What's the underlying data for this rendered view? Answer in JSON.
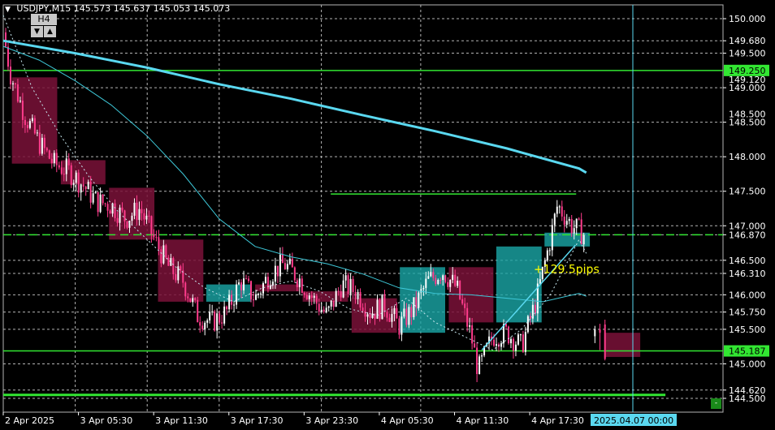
{
  "header": {
    "symbol": "USDJPY,M15",
    "open": "145.573",
    "high": "145.637",
    "low": "145.053",
    "close": "145.073"
  },
  "timeframe": {
    "label": "H4",
    "down_icon": "triangle-down-icon",
    "up_icon": "triangle-up-icon"
  },
  "colors": {
    "background": "#000000",
    "bull": "#ffffff",
    "bear": "#ff3c8c",
    "box_bear": "#7a1238",
    "box_bull": "#1aa7a7",
    "ma_slow": "#5ad8f0",
    "ma_fast": "#3ec8d8",
    "level": "#32e632",
    "grid": "#b4b4b4",
    "annotation": "#ffff00"
  },
  "chart_data": {
    "type": "candlestick",
    "symbol": "USDJPY",
    "timeframe": "M15",
    "ylim": [
      144.3,
      150.2
    ],
    "x_ticks": [
      "2 Apr 2025",
      "3 Apr 05:30",
      "3 Apr 11:30",
      "3 Apr 17:30",
      "3 Apr 23:30",
      "4 Apr 05:30",
      "4 Apr 11:30",
      "4 Apr 17:30"
    ],
    "y_ticks": [
      "150.000",
      "149.680",
      "149.500",
      "149.000",
      "148.500",
      "148.000",
      "147.500",
      "147.000",
      "146.870",
      "146.500",
      "146.310",
      "146.000",
      "145.750",
      "145.500",
      "145.000",
      "144.620",
      "144.500"
    ],
    "partial_labels": [
      "149.120",
      "148.500"
    ],
    "current_time_label": "2025.04.07 00:00",
    "price_tags": [
      {
        "label": "149.250",
        "value": 149.25
      },
      {
        "label": "145.187",
        "value": 145.187
      }
    ],
    "levels": [
      {
        "value": 149.25,
        "style": "solid",
        "x_from": 0,
        "x_to": 1
      },
      {
        "value": 147.46,
        "style": "solid",
        "x_from": 0.455,
        "x_to": 0.796
      },
      {
        "value": 146.87,
        "style": "dashed",
        "x_from": 0,
        "x_to": 1
      },
      {
        "value": 145.187,
        "style": "solid",
        "x_from": 0,
        "x_to": 1
      },
      {
        "value": 144.55,
        "style": "solid-thick",
        "x_from": 0,
        "x_to": 0.92
      }
    ],
    "annotation": {
      "text": "+129.5pips",
      "value": 146.36,
      "x": 0.816
    },
    "series": [
      {
        "kind": "ma-slow",
        "x": [
          0.0,
          0.1,
          0.2,
          0.3,
          0.4,
          0.5,
          0.6,
          0.7,
          0.8,
          0.81
        ],
        "values": [
          149.68,
          149.5,
          149.29,
          149.05,
          148.84,
          148.6,
          148.37,
          148.12,
          147.83,
          147.77
        ]
      },
      {
        "kind": "ma-fast",
        "x": [
          0.0,
          0.05,
          0.1,
          0.15,
          0.2,
          0.25,
          0.3,
          0.35,
          0.4,
          0.45,
          0.5,
          0.55,
          0.6,
          0.65,
          0.7,
          0.75,
          0.8,
          0.81
        ],
        "values": [
          149.6,
          149.4,
          149.1,
          148.75,
          148.3,
          147.75,
          147.1,
          146.7,
          146.55,
          146.45,
          146.3,
          146.1,
          146.02,
          146.0,
          145.95,
          145.9,
          146.02,
          145.98
        ]
      },
      {
        "kind": "ma-dotted",
        "x": [
          0.0,
          0.04,
          0.08,
          0.12,
          0.16,
          0.2,
          0.24,
          0.28,
          0.32,
          0.36,
          0.4,
          0.44,
          0.48,
          0.52,
          0.56,
          0.6,
          0.64,
          0.68,
          0.72,
          0.76,
          0.8,
          0.81
        ],
        "values": [
          150.05,
          149.0,
          148.3,
          147.7,
          147.2,
          146.8,
          146.4,
          146.1,
          145.9,
          146.1,
          146.2,
          146.05,
          145.8,
          145.7,
          145.95,
          145.6,
          145.4,
          145.2,
          145.5,
          146.0,
          146.8,
          146.6
        ]
      }
    ],
    "boxes": [
      {
        "kind": "bear",
        "x0": 0.012,
        "x1": 0.075,
        "top": 149.15,
        "bottom": 147.9
      },
      {
        "kind": "bear",
        "x0": 0.08,
        "x1": 0.142,
        "top": 147.95,
        "bottom": 147.6
      },
      {
        "kind": "bear",
        "x0": 0.147,
        "x1": 0.21,
        "top": 147.55,
        "bottom": 146.8
      },
      {
        "kind": "bear",
        "x0": 0.215,
        "x1": 0.278,
        "top": 146.8,
        "bottom": 145.9
      },
      {
        "kind": "bull",
        "x0": 0.282,
        "x1": 0.345,
        "top": 146.15,
        "bottom": 145.9
      },
      {
        "kind": "bear",
        "x0": 0.35,
        "x1": 0.412,
        "top": 146.15,
        "bottom": 146.05
      },
      {
        "kind": "bear",
        "x0": 0.416,
        "x1": 0.479,
        "top": 146.05,
        "bottom": 145.9
      },
      {
        "kind": "bear",
        "x0": 0.484,
        "x1": 0.547,
        "top": 145.95,
        "bottom": 145.45
      },
      {
        "kind": "bull",
        "x0": 0.551,
        "x1": 0.614,
        "top": 146.4,
        "bottom": 145.45
      },
      {
        "kind": "bear",
        "x0": 0.619,
        "x1": 0.681,
        "top": 146.4,
        "bottom": 145.6
      },
      {
        "kind": "bull",
        "x0": 0.685,
        "x1": 0.748,
        "top": 146.7,
        "bottom": 145.6
      },
      {
        "kind": "bull",
        "x0": 0.752,
        "x1": 0.815,
        "top": 146.9,
        "bottom": 146.7
      },
      {
        "kind": "bear",
        "x0": 0.835,
        "x1": 0.885,
        "top": 145.45,
        "bottom": 145.1
      }
    ],
    "candle_path": [
      [
        0.0,
        149.8
      ],
      [
        0.01,
        149.2
      ],
      [
        0.03,
        148.6
      ],
      [
        0.05,
        148.2
      ],
      [
        0.07,
        147.9
      ],
      [
        0.09,
        147.8
      ],
      [
        0.11,
        147.6
      ],
      [
        0.13,
        147.35
      ],
      [
        0.15,
        147.3
      ],
      [
        0.17,
        147.1
      ],
      [
        0.19,
        147.25
      ],
      [
        0.21,
        146.8
      ],
      [
        0.23,
        146.4
      ],
      [
        0.25,
        146.2
      ],
      [
        0.27,
        145.7
      ],
      [
        0.29,
        145.6
      ],
      [
        0.31,
        145.75
      ],
      [
        0.33,
        146.2
      ],
      [
        0.35,
        145.95
      ],
      [
        0.37,
        146.3
      ],
      [
        0.39,
        146.45
      ],
      [
        0.41,
        146.25
      ],
      [
        0.43,
        145.95
      ],
      [
        0.45,
        145.7
      ],
      [
        0.47,
        146.15
      ],
      [
        0.49,
        146.05
      ],
      [
        0.51,
        145.75
      ],
      [
        0.53,
        145.85
      ],
      [
        0.55,
        145.55
      ],
      [
        0.57,
        145.8
      ],
      [
        0.59,
        146.2
      ],
      [
        0.61,
        146.35
      ],
      [
        0.63,
        146.1
      ],
      [
        0.65,
        145.4
      ],
      [
        0.66,
        144.9
      ],
      [
        0.68,
        145.4
      ],
      [
        0.7,
        145.45
      ],
      [
        0.72,
        145.25
      ],
      [
        0.74,
        145.9
      ],
      [
        0.76,
        146.8
      ],
      [
        0.77,
        147.3
      ],
      [
        0.79,
        147.0
      ],
      [
        0.81,
        146.85
      ]
    ],
    "post_gap_candles": [
      {
        "x": 0.822,
        "open": 145.4,
        "high": 145.55,
        "low": 145.3,
        "close": 145.5
      },
      {
        "x": 0.829,
        "open": 145.5,
        "high": 145.58,
        "low": 145.2,
        "close": 145.45
      },
      {
        "x": 0.836,
        "open": 145.57,
        "high": 145.64,
        "low": 145.05,
        "close": 145.07
      }
    ],
    "grid": true
  }
}
